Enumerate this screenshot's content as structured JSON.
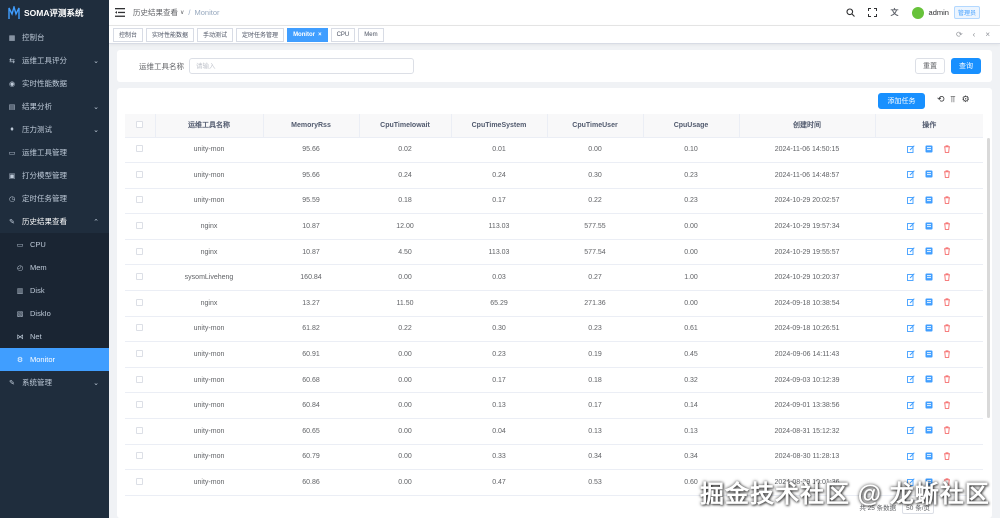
{
  "app": {
    "title": "SOMA评测系统"
  },
  "sidebar": {
    "items": [
      {
        "label": "控制台",
        "icon": "dashboard-icon",
        "arrow": false
      },
      {
        "label": "运维工具评分",
        "icon": "score-icon",
        "arrow": true
      },
      {
        "label": "实时性能数据",
        "icon": "realtime-icon",
        "arrow": false
      },
      {
        "label": "结果分析",
        "icon": "analysis-icon",
        "arrow": true
      },
      {
        "label": "压力测试",
        "icon": "stress-icon",
        "arrow": true
      },
      {
        "label": "运维工具管理",
        "icon": "tool-icon",
        "arrow": false
      },
      {
        "label": "打分模型管理",
        "icon": "model-icon",
        "arrow": false
      },
      {
        "label": "定时任务管理",
        "icon": "timer-icon",
        "arrow": false
      },
      {
        "label": "历史结果查看",
        "icon": "history-icon",
        "arrow": true
      }
    ],
    "submenu": [
      {
        "label": "CPU",
        "icon": "monitor-icon"
      },
      {
        "label": "Mem",
        "icon": "clock-icon"
      },
      {
        "label": "Disk",
        "icon": "disk-icon"
      },
      {
        "label": "DiskIo",
        "icon": "diskio-icon"
      },
      {
        "label": "Net",
        "icon": "net-icon"
      },
      {
        "label": "Monitor",
        "icon": "gear-icon"
      }
    ],
    "bottom": {
      "label": "系统管理",
      "icon": "settings-icon"
    }
  },
  "breadcrumb": {
    "first": "历史结果查看",
    "second": "Monitor",
    "sep": "/"
  },
  "user": {
    "name": "admin",
    "role": "管理员"
  },
  "tags": [
    "控制台",
    "实时性能数据",
    "手动测试",
    "定时任务管理",
    "Monitor",
    "CPU",
    "Mem"
  ],
  "active_tag": "Monitor",
  "search": {
    "label": "运维工具名称",
    "placeholder": "请输入",
    "reset": "重置",
    "query": "查询"
  },
  "toolbar": {
    "add_task": "添加任务"
  },
  "table": {
    "headers": [
      "运维工具名称",
      "MemoryRss",
      "CpuTimeIowait",
      "CpuTimeSystem",
      "CpuTimeUser",
      "CpuUsage",
      "创建时间",
      "操作"
    ],
    "rows": [
      [
        "unity-mon",
        "95.66",
        "0.02",
        "0.01",
        "0.00",
        "0.10",
        "2024-11-06 14:50:15"
      ],
      [
        "unity-mon",
        "95.66",
        "0.24",
        "0.24",
        "0.30",
        "0.23",
        "2024-11-06 14:48:57"
      ],
      [
        "unity-mon",
        "95.59",
        "0.18",
        "0.17",
        "0.22",
        "0.23",
        "2024-10-29 20:02:57"
      ],
      [
        "nginx",
        "10.87",
        "12.00",
        "113.03",
        "577.55",
        "0.00",
        "2024-10-29 19:57:34"
      ],
      [
        "nginx",
        "10.87",
        "4.50",
        "113.03",
        "577.54",
        "0.00",
        "2024-10-29 19:55:57"
      ],
      [
        "sysomLiveheng",
        "160.84",
        "0.00",
        "0.03",
        "0.27",
        "1.00",
        "2024-10-29 10:20:37"
      ],
      [
        "nginx",
        "13.27",
        "11.50",
        "65.29",
        "271.36",
        "0.00",
        "2024-09-18 10:38:54"
      ],
      [
        "unity-mon",
        "61.82",
        "0.22",
        "0.30",
        "0.23",
        "0.61",
        "2024-09-18 10:26:51"
      ],
      [
        "unity-mon",
        "60.91",
        "0.00",
        "0.23",
        "0.19",
        "0.45",
        "2024-09-06 14:11:43"
      ],
      [
        "unity-mon",
        "60.68",
        "0.00",
        "0.17",
        "0.18",
        "0.32",
        "2024-09-03 10:12:39"
      ],
      [
        "unity-mon",
        "60.84",
        "0.00",
        "0.13",
        "0.17",
        "0.14",
        "2024-09-01 13:38:56"
      ],
      [
        "unity-mon",
        "60.65",
        "0.00",
        "0.04",
        "0.13",
        "0.13",
        "2024-08-31 15:12:32"
      ],
      [
        "unity-mon",
        "60.79",
        "0.00",
        "0.33",
        "0.34",
        "0.34",
        "2024-08-30 11:28:13"
      ],
      [
        "unity-mon",
        "60.86",
        "0.00",
        "0.47",
        "0.53",
        "0.60",
        "2024-08-29 10:01:36"
      ]
    ]
  },
  "pagination": {
    "total": "共 25 条数据",
    "page_size": "50 条/页"
  },
  "watermark": "掘金技术社区 @ 龙蜥社区",
  "colors": {
    "sidebar_bg": "#1f2d3d",
    "accent": "#409eff",
    "primary_button": "#1890ff"
  }
}
